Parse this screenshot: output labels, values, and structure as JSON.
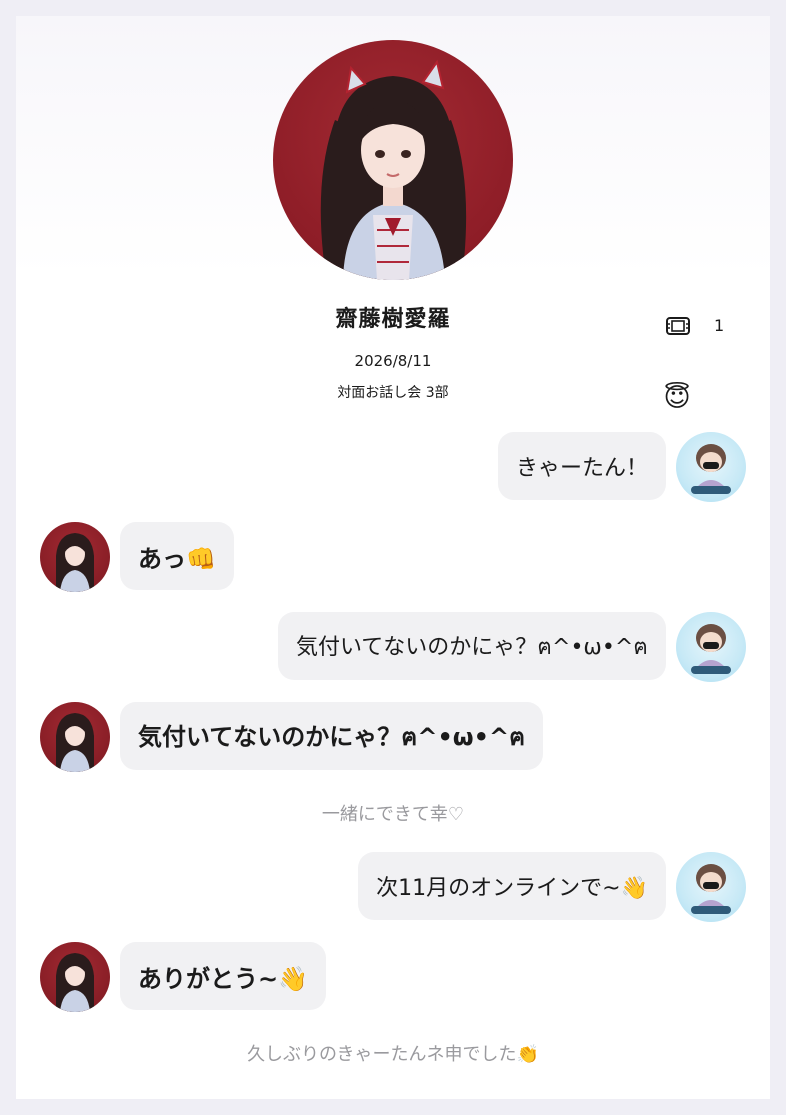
{
  "header": {
    "name": "齋藤樹愛羅",
    "date": "2026/8/11",
    "event": "対面お話し会 3部",
    "ticket_count": "1",
    "sticker_icon": "angel-sticker-icon"
  },
  "messages": [
    {
      "from": "me",
      "text": "きゃーたん！"
    },
    {
      "from": "her",
      "text": "あっ👊"
    },
    {
      "from": "me",
      "text": "気付いてないのかにゃ？ฅ^•ω•^ฅ"
    },
    {
      "from": "her",
      "text": "気付いてないのかにゃ？ฅ^•ω•^ฅ"
    },
    {
      "from": "note",
      "text": "一緒にできて幸♡"
    },
    {
      "from": "me",
      "text": "次11月のオンラインで~👋"
    },
    {
      "from": "her",
      "text": "ありがとう~👋"
    },
    {
      "from": "note",
      "text": "久しぶりのきゃーたんネ申でした👏"
    }
  ],
  "colors": {
    "bubble": "#f1f1f3",
    "note_text": "#9a9a9e",
    "idol_background": "#8e1d27",
    "fan_avatar": "#c7e9f6"
  }
}
